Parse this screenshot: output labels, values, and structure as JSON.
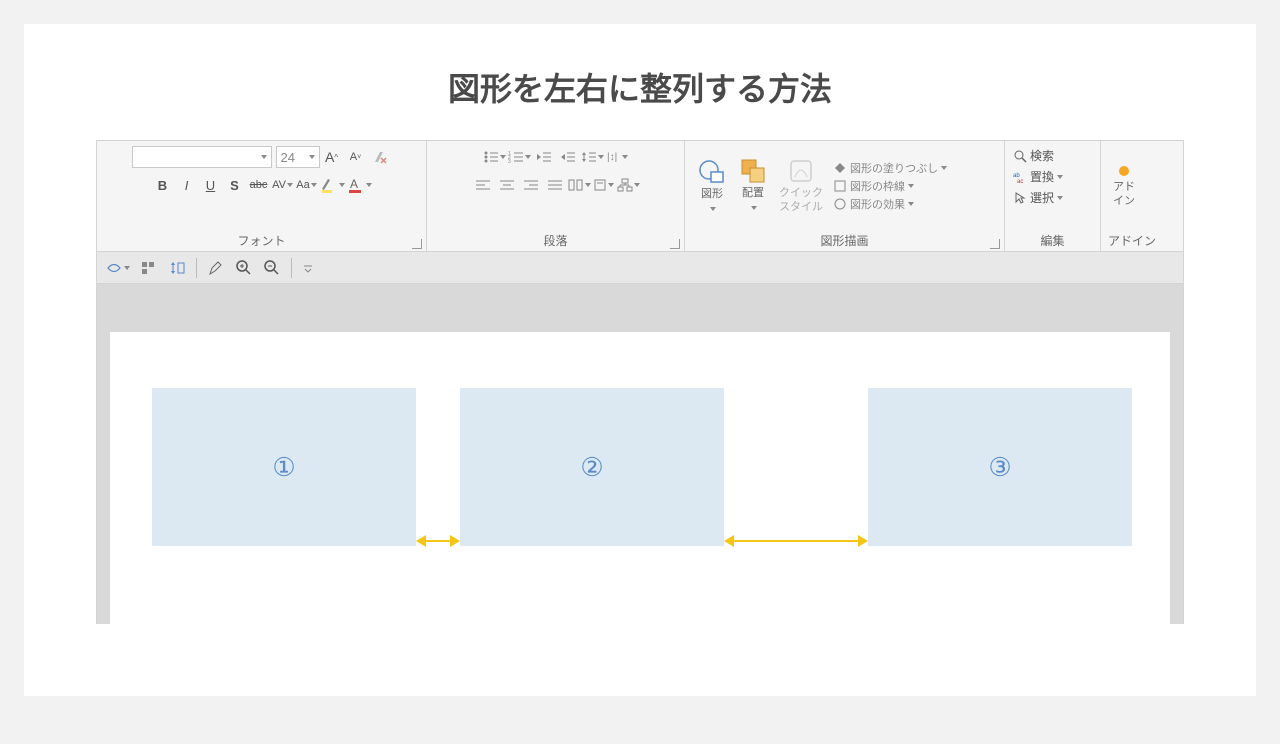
{
  "title": "図形を左右に整列する方法",
  "ribbon": {
    "font": {
      "label": "フォント",
      "size": "24",
      "bold": "B",
      "italic": "I",
      "underline": "U",
      "strike": "S",
      "abc": "abc",
      "av": "AV",
      "aa": "Aa"
    },
    "paragraph": {
      "label": "段落"
    },
    "drawing": {
      "label": "図形描画",
      "shape": "図形",
      "arrange": "配置",
      "quickstyle": "クイック\nスタイル",
      "fill": "図形の塗りつぶし",
      "outline": "図形の枠線",
      "effects": "図形の効果"
    },
    "editing": {
      "label": "編集",
      "find": "検索",
      "replace": "置換",
      "select": "選択"
    },
    "addin": {
      "label": "アドイン",
      "btn": "アド\nイン"
    }
  },
  "shapes": {
    "one": "①",
    "two": "②",
    "three": "③"
  }
}
